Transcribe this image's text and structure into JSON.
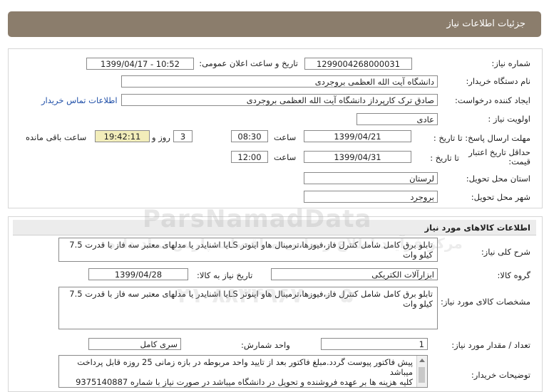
{
  "header": {
    "title": "جزئیات اطلاعات نیاز"
  },
  "need_info": {
    "need_number_label": "شماره نیاز:",
    "need_number": "1299004268000031",
    "announce_label": "تاریخ و ساعت اعلان عمومی:",
    "announce_value": "1399/04/17 - 10:52",
    "buyer_org_label": "نام دستگاه خریدار:",
    "buyer_org": "دانشگاه آیت الله العظمی بروجردی",
    "creator_label": "ایجاد کننده درخواست:",
    "creator": "صادق ترک کارپرداز دانشگاه آیت الله العظمی بروجردی",
    "contact_link": "اطلاعات تماس خریدار",
    "priority_label": "اولویت نیاز :",
    "priority": "عادی",
    "deadline_label": "مهلت ارسال پاسخ: تا تاریخ :",
    "deadline_date": "1399/04/21",
    "time_label": "ساعت",
    "deadline_time": "08:30",
    "days_value": "3",
    "days_label": "روز و",
    "remaining_time": "19:42:11",
    "remaining_label": "ساعت باقی مانده",
    "validity_label": "حداقل تاریخ اعتبار قیمت:",
    "validity_to_label": "تا تاریخ :",
    "validity_date": "1399/04/31",
    "validity_time": "12:00",
    "province_label": "استان محل تحویل:",
    "province": "لرستان",
    "city_label": "شهر محل تحویل:",
    "city": "بروجرد"
  },
  "goods": {
    "section_title": "اطلاعات کالاهای مورد نیاز",
    "summary_label": "شرح کلی نیاز:",
    "summary": "تابلو برق کامل شامل کنترل فاز،فیوزها،ترمینال هاو اینوتر LSیا اشنایدر یا مدلهای معتبر سه فاز با قدرت 7.5 کیلو وات",
    "group_label": "گروه کالا:",
    "group": "ابزارآلات الکتریکی",
    "need_date_label": "تاریخ نیاز به کالا:",
    "need_date": "1399/04/28",
    "specs_label": "مشخصات کالای مورد نیاز:",
    "specs": "تابلو برق کامل شامل کنترل فاز،فیوزها،ترمینال هاو اینوتر LSیا اشنایدر یا مدلهای معتبر سه فاز با قدرت 7.5 کیلو وات",
    "qty_label": "تعداد / مقدار مورد نیاز:",
    "qty": "1",
    "unit_label": "واحد شمارش:",
    "unit": "سری کامل",
    "buyer_notes_label": "توضیحات خریدار:",
    "buyer_notes_line1": "پیش فاکتور پیوست گردد.مبلغ فاکتور بعد از تایید واحد مربوطه در بازه زمانی 25 روزه قابل پرداخت میباشد",
    "buyer_notes_line2": "کلیه هزینه ها بر عهده فروشنده و تحویل در دانشگاه میباشد در صورت نیاز با شماره 9375140887"
  },
  "watermark": {
    "brand": "ParsNamadData",
    "fa": "مرکز فرآیند اطلاع رسانی مناقصات پارس نماد داده",
    "phone": "۰۲۱-۸۸۳۴۹۶۷۰ - ۵"
  }
}
